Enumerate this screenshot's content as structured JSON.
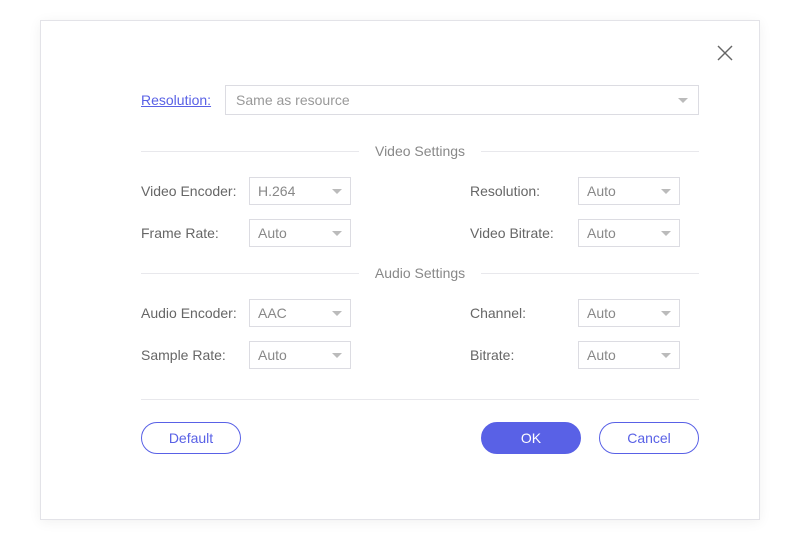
{
  "topResolution": {
    "label": "Resolution:",
    "value": "Same as resource"
  },
  "sections": {
    "video": {
      "title": "Video Settings",
      "fields": {
        "encoder": {
          "label": "Video Encoder:",
          "value": "H.264"
        },
        "resolution": {
          "label": "Resolution:",
          "value": "Auto"
        },
        "frameRate": {
          "label": "Frame Rate:",
          "value": "Auto"
        },
        "bitrate": {
          "label": "Video Bitrate:",
          "value": "Auto"
        }
      }
    },
    "audio": {
      "title": "Audio Settings",
      "fields": {
        "encoder": {
          "label": "Audio Encoder:",
          "value": "AAC"
        },
        "channel": {
          "label": "Channel:",
          "value": "Auto"
        },
        "sampleRate": {
          "label": "Sample Rate:",
          "value": "Auto"
        },
        "bitrate": {
          "label": "Bitrate:",
          "value": "Auto"
        }
      }
    }
  },
  "buttons": {
    "default": "Default",
    "ok": "OK",
    "cancel": "Cancel"
  }
}
